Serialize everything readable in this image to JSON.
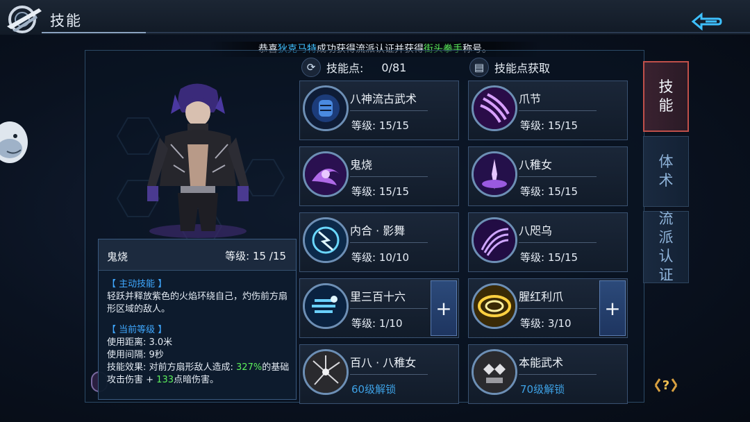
{
  "header": {
    "title": "技能"
  },
  "announcement": {
    "prefix": "恭喜",
    "player": "狄克马特",
    "middle": "成功获得流派认证并获得",
    "honor": "街头拳手",
    "suffix": "称号。"
  },
  "skill_points": {
    "label": "技能点:",
    "value": "0/81"
  },
  "acquire": {
    "label": "技能点获取"
  },
  "tabs": [
    {
      "label": "技能"
    },
    {
      "label": "体术"
    },
    {
      "label": "流派认证"
    }
  ],
  "skills": [
    {
      "name": "八神流古武术",
      "level": "等级: 15/15"
    },
    {
      "name": "爪节",
      "level": "等级: 15/15"
    },
    {
      "name": "鬼烧",
      "level": "等级: 15/15"
    },
    {
      "name": "八稚女",
      "level": "等级: 15/15"
    },
    {
      "name": "内合 · 影舞",
      "level": "等级: 10/10"
    },
    {
      "name": "八咫乌",
      "level": "等级: 15/15"
    },
    {
      "name": "里三百十六",
      "level": "等级: 1/10",
      "plus": "+"
    },
    {
      "name": "腥红利爪",
      "level": "等级: 3/10",
      "plus": "+"
    },
    {
      "name": "百八 · 八稚女",
      "unlock": "60级解锁"
    },
    {
      "name": "本能武术",
      "unlock": "70级解锁"
    }
  ],
  "tooltip": {
    "name": "鬼烧",
    "level": "等级: 15 /15",
    "active_title": "【 主动技能 】",
    "active_desc": "轻跃并释放紫色的火焰环绕自己，灼伤前方扇形区域的敌人。",
    "current_title": "【 当前等级 】",
    "range": "使用距离: 3.0米",
    "interval": "使用间隔: 9秒",
    "effect_prefix": "技能效果: 对前方扇形敌人造成: ",
    "effect_value1": "327%",
    "effect_mid": "的基础攻击伤害 + ",
    "effect_value2": "133",
    "effect_suffix": "点暗伤害。"
  },
  "colors": {
    "highlight_blue": "#3fc0ff",
    "highlight_green": "#5cf05c",
    "unlock_blue": "#3ea2e6",
    "active_tab_border": "#c0504a"
  },
  "icons": [
    "logo-icon",
    "back-icon",
    "refresh-icon",
    "book-icon",
    "help-icon",
    "mascot-icon"
  ]
}
